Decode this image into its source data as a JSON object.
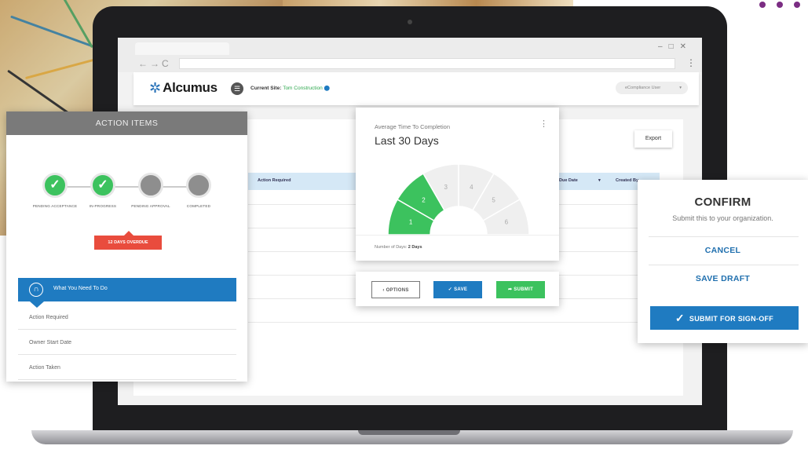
{
  "header": {
    "logo_text": "Alcumus",
    "current_site_label": "Current Site:",
    "current_site_value": "Tom Construction",
    "user_select": "eCompliance User"
  },
  "main": {
    "export_label": "Export",
    "columns": [
      "Action Required",
      "Due Date",
      "Created By"
    ]
  },
  "action_items": {
    "title": "ACTION ITEMS",
    "steps": [
      {
        "label": "PENDING ACCEPTANCE",
        "status": "done"
      },
      {
        "label": "IN-PROGRESS",
        "status": "done"
      },
      {
        "label": "PENDING APPROVAL",
        "status": "pending"
      },
      {
        "label": "COMPLETED",
        "status": "pending"
      }
    ],
    "overdue_badge": "12 DAYS OVERDUE",
    "section_title": "What You Need To Do",
    "list": [
      "Action Required",
      "Owner Start Date",
      "Action Taken"
    ]
  },
  "time_card": {
    "subtitle": "Average Time To Completion",
    "title": "Last 30 Days",
    "segments": [
      "1",
      "2",
      "3",
      "4",
      "5",
      "6"
    ],
    "highlighted_segments": 2,
    "footer_label": "Number of Days:",
    "footer_value": "2 Days"
  },
  "actions": {
    "options": "OPTIONS",
    "save": "SAVE",
    "submit": "SUBMIT"
  },
  "confirm": {
    "title": "CONFIRM",
    "subtitle": "Submit this to your organization.",
    "cancel": "CANCEL",
    "save_draft": "SAVE DRAFT",
    "submit_signoff": "SUBMIT FOR SIGN-OFF"
  },
  "colors": {
    "brand_blue": "#1f7bc1",
    "success_green": "#3cc25e",
    "overdue_red": "#e94c3d",
    "accent_purple": "#7b2d83"
  }
}
